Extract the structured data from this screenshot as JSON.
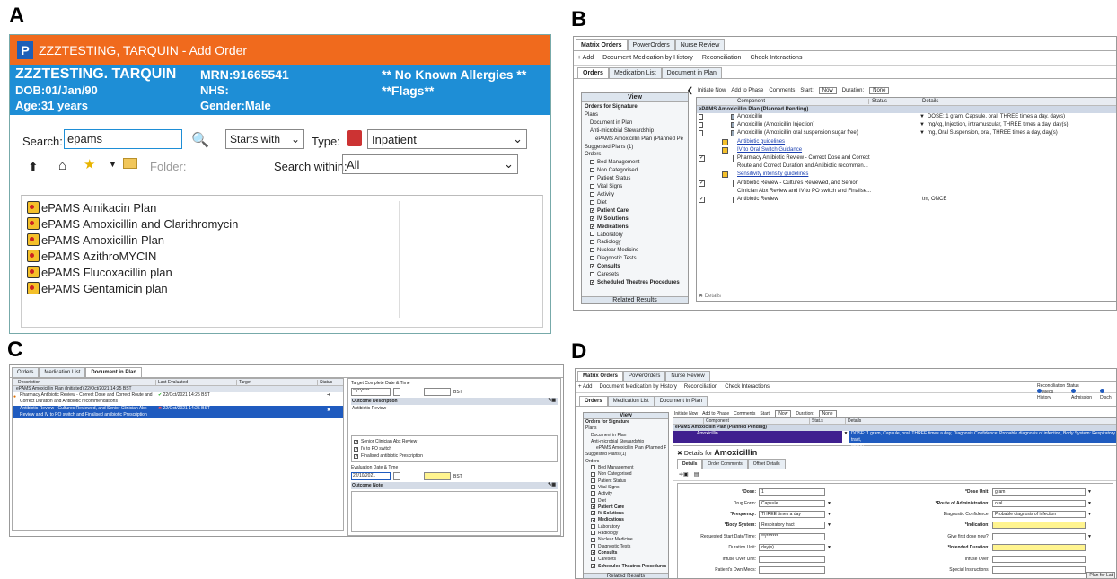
{
  "panels": {
    "a": "A",
    "b": "B",
    "c": "C",
    "d": "D"
  },
  "a": {
    "title": "ZZZTESTING, TARQUIN  - Add Order",
    "patient_name": "ZZZTESTING. TARQUIN",
    "mrn": "MRN:91665541",
    "allergies": "** No Known Allergies **",
    "dob": "DOB:01/Jan/90",
    "nhs": "NHS:",
    "flags": "**Flags**",
    "age": "Age:31 years",
    "gender": "Gender:Male",
    "search_label": "Search:",
    "search_value": "epams",
    "starts_with": "Starts with",
    "type_label": "Type:",
    "type_value": "Inpatient",
    "folder_label": "Folder:",
    "search_within_label": "Search within:",
    "search_within_value": "All",
    "results": [
      "ePAMS Amikacin Plan",
      "ePAMS Amoxicillin and Clarithromycin",
      "ePAMS Amoxicillin Plan",
      "ePAMS AzithroMYCIN",
      "ePAMS Flucoxacillin plan",
      "ePAMS Gentamicin plan"
    ]
  },
  "b": {
    "top_tabs": [
      "Matrix Orders",
      "PowerOrders",
      "Nurse Review"
    ],
    "toolbar": [
      "+ Add",
      "Document Medication by History",
      "Reconciliation",
      "Check Interactions"
    ],
    "sub_tabs": [
      "Orders",
      "Medication List",
      "Document in Plan"
    ],
    "view_title": "View",
    "tree": [
      "Orders for Signature",
      "Plans",
      "Document in Plan",
      "Anti-microbial Stewardship",
      "ePAMS Amoxicillin Plan (Planned Pe",
      "Suggested Plans (1)",
      "Orders",
      "Bed Management",
      "Non Categorised",
      "Patient Status",
      "Vital Signs",
      "Activity",
      "Diet",
      "Patient Care",
      "IV Solutions",
      "Medications",
      "Laboratory",
      "Radiology",
      "Nuclear Medicine",
      "Diagnostic Tests",
      "Consults",
      "Caresets",
      "Scheduled Theatres Procedures"
    ],
    "related_results": "Related Results",
    "order_toolbar": [
      "Initiate Now",
      "Add to Phase",
      "Comments",
      "Start:",
      "Now",
      "Duration:",
      "None"
    ],
    "headers": [
      "Component",
      "Status",
      "Details"
    ],
    "plan_header": "ePAMS Amoxicillin Plan (Planned Pending)",
    "rows": [
      {
        "c": "Amoxicillin",
        "d": "DOSE: 1 gram, Capsule, oral, THREE times a day, day(s)"
      },
      {
        "c": "Amoxicillin (Amoxicillin Injection)",
        "d": "mg/kg, Injection, intramuscular, THREE times a day, day(s)"
      },
      {
        "c": "Amoxicillin (Amoxicillin oral suspension sugar free)",
        "d": "mg, Oral Suspension, oral, THREE times a day, day(s)"
      },
      {
        "c": "Antibiotic guidelines",
        "d": ""
      },
      {
        "c": "IV to Oral Switch Guidance",
        "d": ""
      },
      {
        "c": "Pharmacy Antibiotic Review - Correct Dose and Correct",
        "d": ""
      },
      {
        "c": "Route and Correct Duration and Antibiotic recommen...",
        "d": ""
      },
      {
        "c": "Sensitivity intensity guidelines",
        "d": ""
      },
      {
        "c": "Antibiotic Review - Cultures Reviewed, and Senior",
        "d": ""
      },
      {
        "c": "Clinician Abx Review and IV to PO switch and Finalise...",
        "d": ""
      },
      {
        "c": "Antibiotic Review",
        "d": "tm, ONCE"
      }
    ],
    "details": "Details"
  },
  "c": {
    "tabs": [
      "Orders",
      "Medication List",
      "Document in Plan"
    ],
    "headers": [
      "Description",
      "Last Evaluated",
      "Target",
      "Status"
    ],
    "plan_row": "ePAMS Amoxicillin Plan (Initiated) 22/Oct/2021 14:25 BST",
    "row1a": "Pharmacy Antibiotic Review - Correct Dose and Correct Route and",
    "row1b": "Correct Duration and Antibiotic recommendations",
    "row1_date": "22/Oct/2021 14:25 BST",
    "row2a": "Antibiotic Review - Cultures Reviewed, and Senior Clinician Abx",
    "row2b": "Review and IV to PO switch and Finalised antibiotic Prescription",
    "row2_date": "22/Oct/2021 14:25 BST",
    "target_label": "Target Complete Date & Time",
    "date_placeholder": "**/**/****",
    "bst": "BST",
    "outcome_desc": "Outcome Description",
    "outcome_value": "Antibiotic Review",
    "checks": [
      "Senior Clinician Abx Review",
      "IV to PO switch",
      "Finalised antibiotic Prescription"
    ],
    "eval_label": "Evaluation Date & Time",
    "eval_value": "22/10/2021",
    "outcome_note": "Outcome Note"
  },
  "d": {
    "top_tabs": [
      "Matrix Orders",
      "PowerOrders",
      "Nurse Review"
    ],
    "toolbar": [
      "+ Add",
      "Document Medication by History",
      "Reconciliation",
      "Check Interactions"
    ],
    "recon_title": "Reconciliation Status",
    "recon_items": [
      "Meds History",
      "Admission",
      "Disch"
    ],
    "sub_tabs": [
      "Orders",
      "Medication List",
      "Document in Plan"
    ],
    "order_toolbar": [
      "Initiate Now",
      "Add to Phase",
      "Comments",
      "Start:",
      "Now",
      "Duration:",
      "None"
    ],
    "headers": [
      "Component",
      "Stat.s",
      "Details"
    ],
    "plan_header": "ePAMS Amoxicillin Plan (Planned Pending)",
    "selected_component": "Amoxicillin",
    "selected_details": "DOSE: 1 gram, Capsule, oral, THREE times a day, Diagnosis Confidence: Probable diagnosis of infection, Body System: Respiratory tract,",
    "selected_details2": "day(s)",
    "details_for": "Details for",
    "drug": "Amoxicillin",
    "detail_tabs": [
      "Details",
      "Order Comments",
      "Offset Details"
    ],
    "left_fields": [
      {
        "l": "*Dose:",
        "v": "1"
      },
      {
        "l": "Drug Form:",
        "v": "Capsule"
      },
      {
        "l": "*Frequency:",
        "v": "THREE times a day"
      },
      {
        "l": "*Body System:",
        "v": "Respiratory tract"
      },
      {
        "l": "Requested Start Date/Time:",
        "v": "**/**/****"
      },
      {
        "l": "Duration Unit:",
        "v": "day(s)"
      },
      {
        "l": "Infuse Over Unit:",
        "v": ""
      },
      {
        "l": "Patient's Own Meds:",
        "v": ""
      }
    ],
    "right_fields": [
      {
        "l": "*Dose Unit:",
        "v": "gram"
      },
      {
        "l": "*Route of Administration:",
        "v": "oral"
      },
      {
        "l": "Diagnostic Confidence:",
        "v": "Probable diagnosis of infection"
      },
      {
        "l": "*Indication:",
        "v": ""
      },
      {
        "l": "Give first dose now?:",
        "v": ""
      },
      {
        "l": "*Intended Duration:",
        "v": ""
      },
      {
        "l": "Infuse Over:",
        "v": ""
      },
      {
        "l": "Special Instructions:",
        "v": ""
      }
    ],
    "related_results": "Related Results",
    "plan_for_later": "Plan for Lat"
  },
  "colors": {
    "orange": "#f06a1d",
    "blue": "#1e8ed6",
    "navy": "#3f1f8f",
    "selected": "#1f5bbf"
  }
}
